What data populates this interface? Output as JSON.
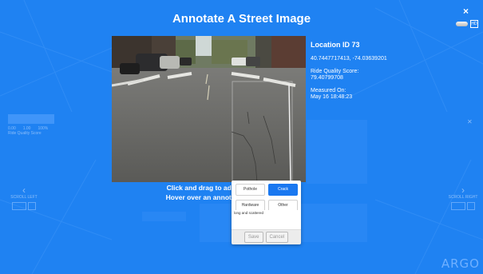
{
  "modal": {
    "title": "Annotate A Street Image",
    "close_glyph": "×",
    "mini_toolbar_label": "HD"
  },
  "location": {
    "heading": "Location ID 73",
    "coords": "40.7447717413, -74.03639201",
    "ride_quality_label": "Ride Quality Score:",
    "ride_quality_value": "79.40799708",
    "measured_label": "Measured On:",
    "measured_value": "May 16 18:48:23"
  },
  "instructions": {
    "line1": "Click and drag to add an a",
    "line2": "Hover over an annotation t"
  },
  "annotation_popup": {
    "categories": [
      {
        "label": "Pothole",
        "selected": false
      },
      {
        "label": "Crack",
        "selected": true
      },
      {
        "label": "Hardware",
        "selected": false
      },
      {
        "label": "Other",
        "selected": false
      }
    ],
    "note_value": "long and scattered",
    "save_label": "Save",
    "cancel_label": "Cancel"
  },
  "background": {
    "left_caption": "Ride Quality Score",
    "left_values": [
      "0.00",
      "1.00",
      "100%"
    ],
    "scroll_left_label": "SCROLL LEFT",
    "scroll_right_label": "SCROLL RIGHT",
    "logo_text": "ARGO"
  },
  "colors": {
    "background": "#1f82f2",
    "accent": "#1a78f0"
  }
}
